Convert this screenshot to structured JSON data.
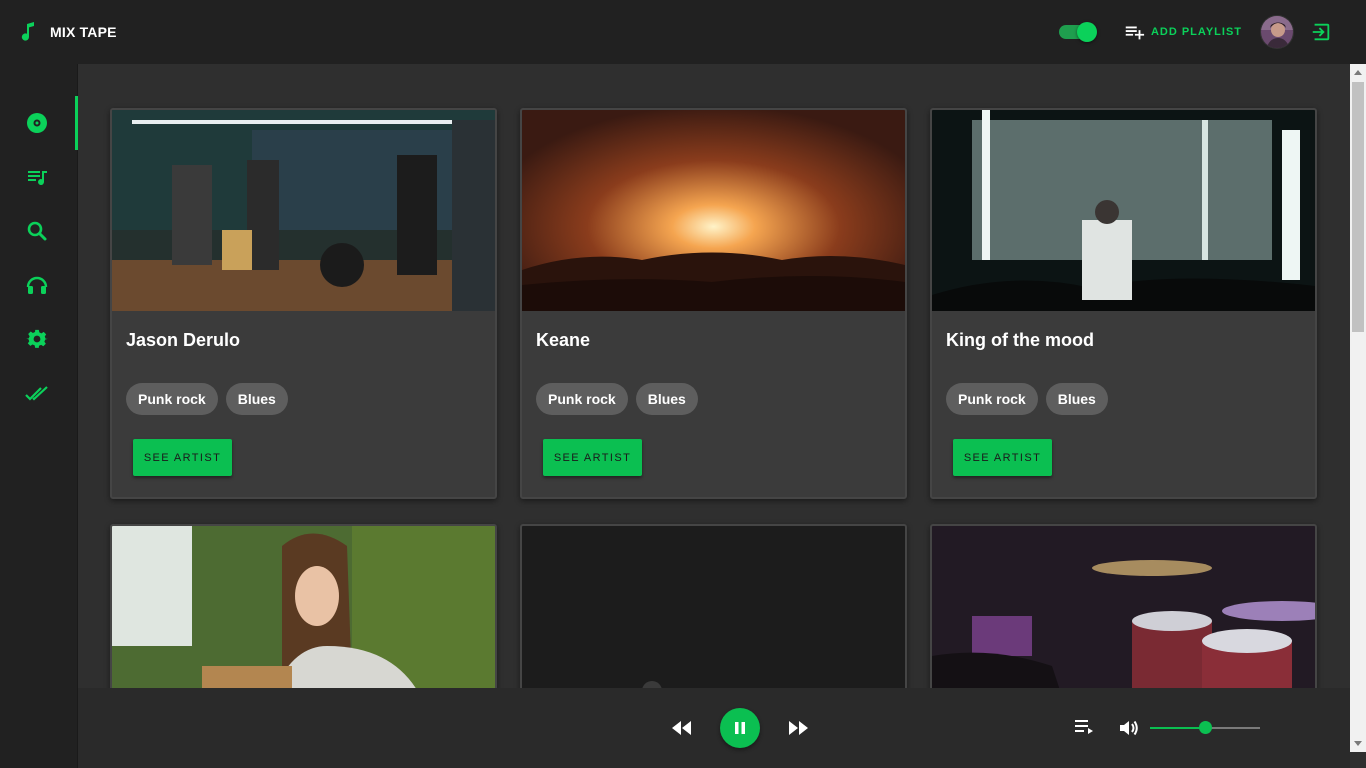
{
  "app": {
    "title": "MIX TAPE"
  },
  "header": {
    "add_playlist_label": "ADD PLAYLIST",
    "theme_toggle_on": true
  },
  "sidebar": {
    "items": [
      {
        "icon": "disc-icon",
        "active": true
      },
      {
        "icon": "playlist-icon",
        "active": false
      },
      {
        "icon": "search-icon",
        "active": false
      },
      {
        "icon": "headphones-icon",
        "active": false
      },
      {
        "icon": "gear-icon",
        "active": false
      },
      {
        "icon": "double-check-icon",
        "active": false
      }
    ]
  },
  "artists": [
    {
      "name": "Jason Derulo",
      "genres": [
        "Punk rock",
        "Blues"
      ],
      "button": "SEE ARTIST",
      "image": "band-rehearsal-photo"
    },
    {
      "name": "Keane",
      "genres": [
        "Punk rock",
        "Blues"
      ],
      "button": "SEE ARTIST",
      "image": "concert-crowd-photo"
    },
    {
      "name": "King of the mood",
      "genres": [
        "Punk rock",
        "Blues"
      ],
      "button": "SEE ARTIST",
      "image": "dj-lights-photo"
    },
    {
      "name": "",
      "genres": [],
      "button": "",
      "image": "girl-guitar-photo"
    },
    {
      "name": "",
      "genres": [],
      "button": "",
      "image": "dark-stage-photo"
    },
    {
      "name": "",
      "genres": [],
      "button": "",
      "image": "drum-kit-photo"
    }
  ],
  "player": {
    "state": "playing",
    "volume": 0.5
  },
  "colors": {
    "accent": "#0bd15a",
    "background": "#2f2f2f",
    "bar": "#212121",
    "card": "#3b3b3b"
  }
}
